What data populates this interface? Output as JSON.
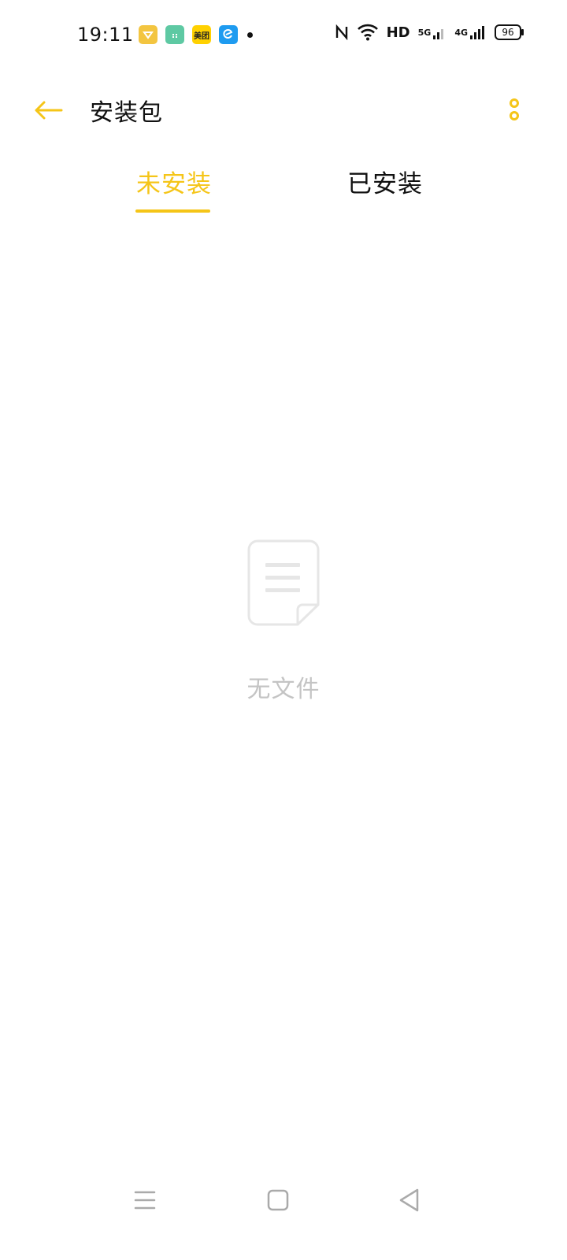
{
  "status_bar": {
    "time": "19:11",
    "meituan_label": "美团",
    "hd_label": "HD",
    "net_5g_label": "5G",
    "net_4g_label": "4G",
    "battery_level": "96"
  },
  "header": {
    "title": "安装包"
  },
  "tabs": [
    {
      "label": "未安装",
      "active": true
    },
    {
      "label": "已安装",
      "active": false
    }
  ],
  "empty_state": {
    "message": "无文件"
  },
  "colors": {
    "accent": "#f5c518",
    "empty_text": "#c4c4c4"
  }
}
